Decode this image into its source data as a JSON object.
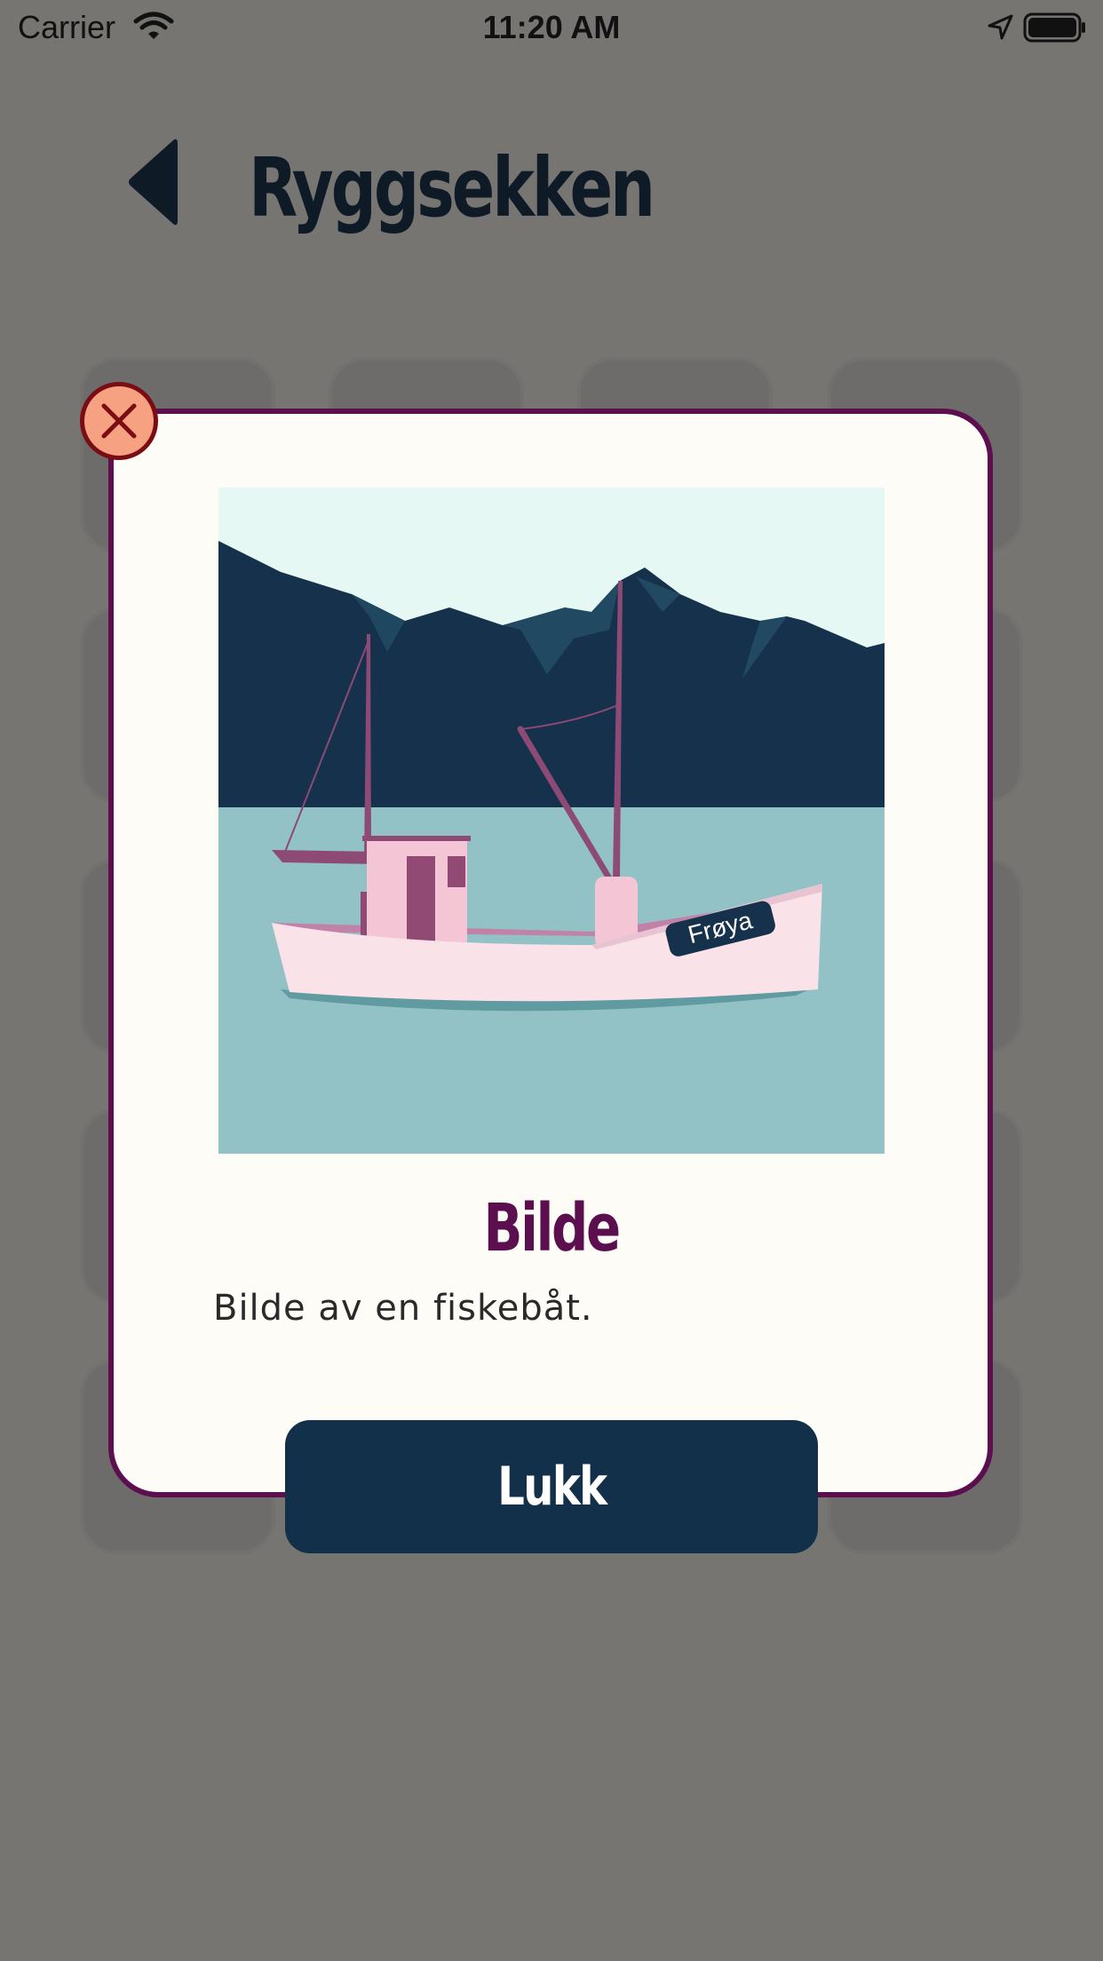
{
  "status_bar": {
    "carrier": "Carrier",
    "time": "11:20 AM"
  },
  "header": {
    "title": "Ryggsekken"
  },
  "modal": {
    "item_title": "Bilde",
    "item_description": "Bilde av en fiskebåt.",
    "close_button_label": "Lukk",
    "picture": {
      "boat_name": "Frøya"
    }
  },
  "icons": {
    "back": "back-arrow-icon",
    "close": "close-x-icon",
    "wifi": "wifi-icon",
    "location": "location-arrow-icon",
    "battery": "battery-icon"
  },
  "colors": {
    "overlay": "#767572",
    "modal_bg": "#fefcf6",
    "modal_border": "#5b0f4f",
    "title": "#5b0f4f",
    "button_bg": "#13304b",
    "close_bg": "#f5a182",
    "close_border": "#7a0d14"
  }
}
